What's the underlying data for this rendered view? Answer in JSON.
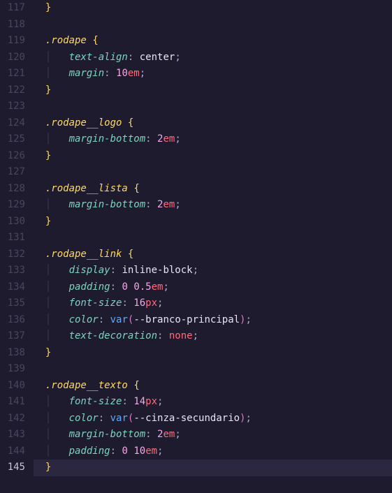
{
  "gutter": {
    "start": 117,
    "end": 145,
    "active": 145
  },
  "lines": {
    "117": [
      [
        "ig",
        "  "
      ],
      [
        "br",
        "}"
      ]
    ],
    "118": [],
    "119": [
      [
        "ig",
        "  "
      ],
      [
        "sel",
        ".rodape"
      ],
      [
        "p",
        " "
      ],
      [
        "br",
        "{"
      ]
    ],
    "120": [
      [
        "ig",
        "  "
      ],
      [
        "ig",
        "│   "
      ],
      [
        "prop",
        "text-align"
      ],
      [
        "p",
        ": "
      ],
      [
        "val",
        "center"
      ],
      [
        "p",
        ";"
      ]
    ],
    "121": [
      [
        "ig",
        "  "
      ],
      [
        "ig",
        "│   "
      ],
      [
        "prop",
        "margin"
      ],
      [
        "p",
        ": "
      ],
      [
        "num",
        "10"
      ],
      [
        "unit",
        "em"
      ],
      [
        "p",
        ";"
      ]
    ],
    "122": [
      [
        "ig",
        "  "
      ],
      [
        "br",
        "}"
      ]
    ],
    "123": [],
    "124": [
      [
        "ig",
        "  "
      ],
      [
        "sel",
        ".rodape__logo"
      ],
      [
        "p",
        " "
      ],
      [
        "br",
        "{"
      ]
    ],
    "125": [
      [
        "ig",
        "  "
      ],
      [
        "ig",
        "│   "
      ],
      [
        "prop",
        "margin-bottom"
      ],
      [
        "p",
        ": "
      ],
      [
        "num",
        "2"
      ],
      [
        "unit",
        "em"
      ],
      [
        "p",
        ";"
      ]
    ],
    "126": [
      [
        "ig",
        "  "
      ],
      [
        "br",
        "}"
      ]
    ],
    "127": [],
    "128": [
      [
        "ig",
        "  "
      ],
      [
        "sel",
        ".rodape__lista"
      ],
      [
        "p",
        " "
      ],
      [
        "br",
        "{"
      ]
    ],
    "129": [
      [
        "ig",
        "  "
      ],
      [
        "ig",
        "│   "
      ],
      [
        "prop",
        "margin-bottom"
      ],
      [
        "p",
        ": "
      ],
      [
        "num",
        "2"
      ],
      [
        "unit",
        "em"
      ],
      [
        "p",
        ";"
      ]
    ],
    "130": [
      [
        "ig",
        "  "
      ],
      [
        "br",
        "}"
      ]
    ],
    "131": [],
    "132": [
      [
        "ig",
        "  "
      ],
      [
        "sel",
        ".rodape__link"
      ],
      [
        "p",
        " "
      ],
      [
        "br",
        "{"
      ]
    ],
    "133": [
      [
        "ig",
        "  "
      ],
      [
        "ig",
        "│   "
      ],
      [
        "prop",
        "display"
      ],
      [
        "p",
        ": "
      ],
      [
        "val",
        "inline-block"
      ],
      [
        "p",
        ";"
      ]
    ],
    "134": [
      [
        "ig",
        "  "
      ],
      [
        "ig",
        "│   "
      ],
      [
        "prop",
        "padding"
      ],
      [
        "p",
        ": "
      ],
      [
        "num",
        "0"
      ],
      [
        "p",
        " "
      ],
      [
        "num",
        "0.5"
      ],
      [
        "unit",
        "em"
      ],
      [
        "p",
        ";"
      ]
    ],
    "135": [
      [
        "ig",
        "  "
      ],
      [
        "ig",
        "│   "
      ],
      [
        "prop",
        "font-size"
      ],
      [
        "p",
        ": "
      ],
      [
        "num",
        "16"
      ],
      [
        "unit",
        "px"
      ],
      [
        "p",
        ";"
      ]
    ],
    "136": [
      [
        "ig",
        "  "
      ],
      [
        "ig",
        "│   "
      ],
      [
        "prop",
        "color"
      ],
      [
        "p",
        ": "
      ],
      [
        "fn",
        "var"
      ],
      [
        "brp",
        "("
      ],
      [
        "val",
        "--branco-principal"
      ],
      [
        "brp",
        ")"
      ],
      [
        "p",
        ";"
      ]
    ],
    "137": [
      [
        "ig",
        "  "
      ],
      [
        "ig",
        "│   "
      ],
      [
        "prop",
        "text-decoration"
      ],
      [
        "p",
        ": "
      ],
      [
        "key",
        "none"
      ],
      [
        "p",
        ";"
      ]
    ],
    "138": [
      [
        "ig",
        "  "
      ],
      [
        "br",
        "}"
      ]
    ],
    "139": [],
    "140": [
      [
        "ig",
        "  "
      ],
      [
        "sel",
        ".rodape__texto"
      ],
      [
        "p",
        " "
      ],
      [
        "br",
        "{"
      ]
    ],
    "141": [
      [
        "ig",
        "  "
      ],
      [
        "ig",
        "│   "
      ],
      [
        "prop",
        "font-size"
      ],
      [
        "p",
        ": "
      ],
      [
        "num",
        "14"
      ],
      [
        "unit",
        "px"
      ],
      [
        "p",
        ";"
      ]
    ],
    "142": [
      [
        "ig",
        "  "
      ],
      [
        "ig",
        "│   "
      ],
      [
        "prop",
        "color"
      ],
      [
        "p",
        ": "
      ],
      [
        "fn",
        "var"
      ],
      [
        "brp",
        "("
      ],
      [
        "val",
        "--cinza-secundario"
      ],
      [
        "brp",
        ")"
      ],
      [
        "p",
        ";"
      ]
    ],
    "143": [
      [
        "ig",
        "  "
      ],
      [
        "ig",
        "│   "
      ],
      [
        "prop",
        "margin-bottom"
      ],
      [
        "p",
        ": "
      ],
      [
        "num",
        "2"
      ],
      [
        "unit",
        "em"
      ],
      [
        "p",
        ";"
      ]
    ],
    "144": [
      [
        "ig",
        "  "
      ],
      [
        "ig",
        "│   "
      ],
      [
        "prop",
        "padding"
      ],
      [
        "p",
        ": "
      ],
      [
        "num",
        "0"
      ],
      [
        "p",
        " "
      ],
      [
        "num",
        "10"
      ],
      [
        "unit",
        "em"
      ],
      [
        "p",
        ";"
      ]
    ],
    "145": [
      [
        "ig",
        "  "
      ],
      [
        "br",
        "}"
      ]
    ]
  }
}
